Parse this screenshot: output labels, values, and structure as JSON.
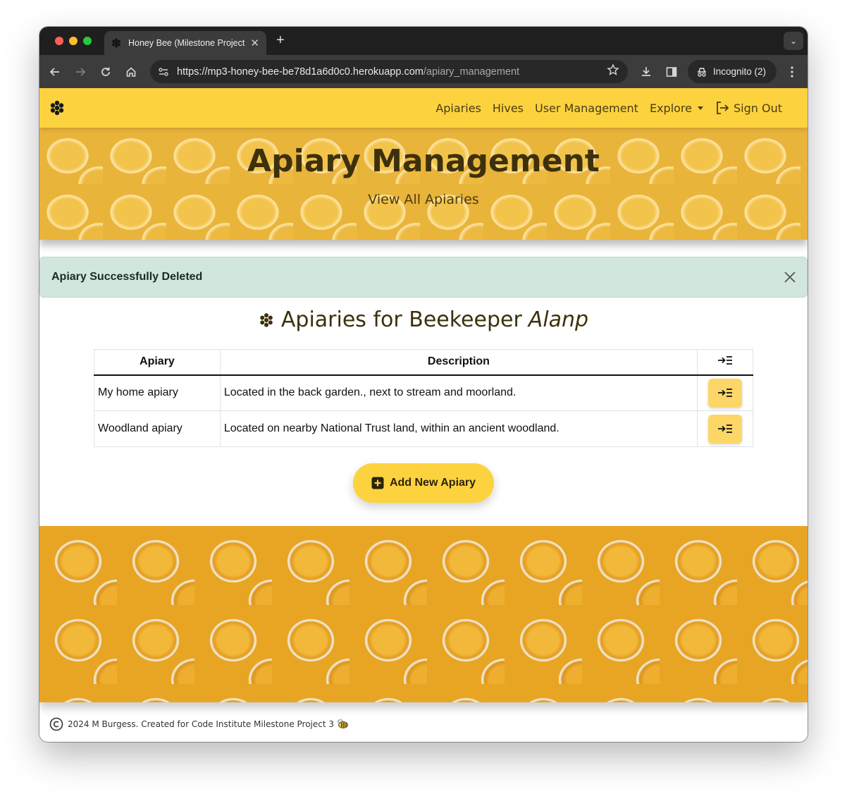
{
  "browser": {
    "tab_title": "Honey Bee (Milestone Project 3)",
    "url_main": "https://mp3-honey-bee-be78d1a6d0c0.herokuapp.com",
    "url_path": "/apiary_management",
    "incognito_label": "Incognito (2)"
  },
  "navbar": {
    "links": [
      "Apiaries",
      "Hives",
      "User Management"
    ],
    "explore_label": "Explore",
    "signout_label": "Sign Out"
  },
  "hero": {
    "title": "Apiary Management",
    "subtitle": "View All Apiaries"
  },
  "alert": {
    "message": "Apiary Successfully Deleted"
  },
  "section": {
    "title_prefix": "Apiaries for Beekeeper",
    "beekeeper": "Alanp"
  },
  "table": {
    "headers": {
      "apiary": "Apiary",
      "description": "Description"
    },
    "rows": [
      {
        "apiary": "My home apiary",
        "description": "Located in the back garden., next to stream and moorland."
      },
      {
        "apiary": "Woodland apiary",
        "description": "Located on nearby National Trust land, within an ancient woodland."
      }
    ]
  },
  "add_button_label": "Add New Apiary",
  "footer": {
    "text": "2024 M Burgess. Created for Code Institute Milestone Project 3"
  },
  "icons": {
    "brand": "honeycomb-flower-icon",
    "view": "arrow-to-list-icon",
    "add": "plus-square-icon",
    "signout": "sign-out-icon",
    "close": "close-icon",
    "copyright": "copyright-icon",
    "bee": "bee-emoji-icon"
  },
  "colors": {
    "navbar": "#fcd33f",
    "text_brown": "#3d300c",
    "alert_bg": "#d1e7dd",
    "view_button": "#fcd667"
  }
}
